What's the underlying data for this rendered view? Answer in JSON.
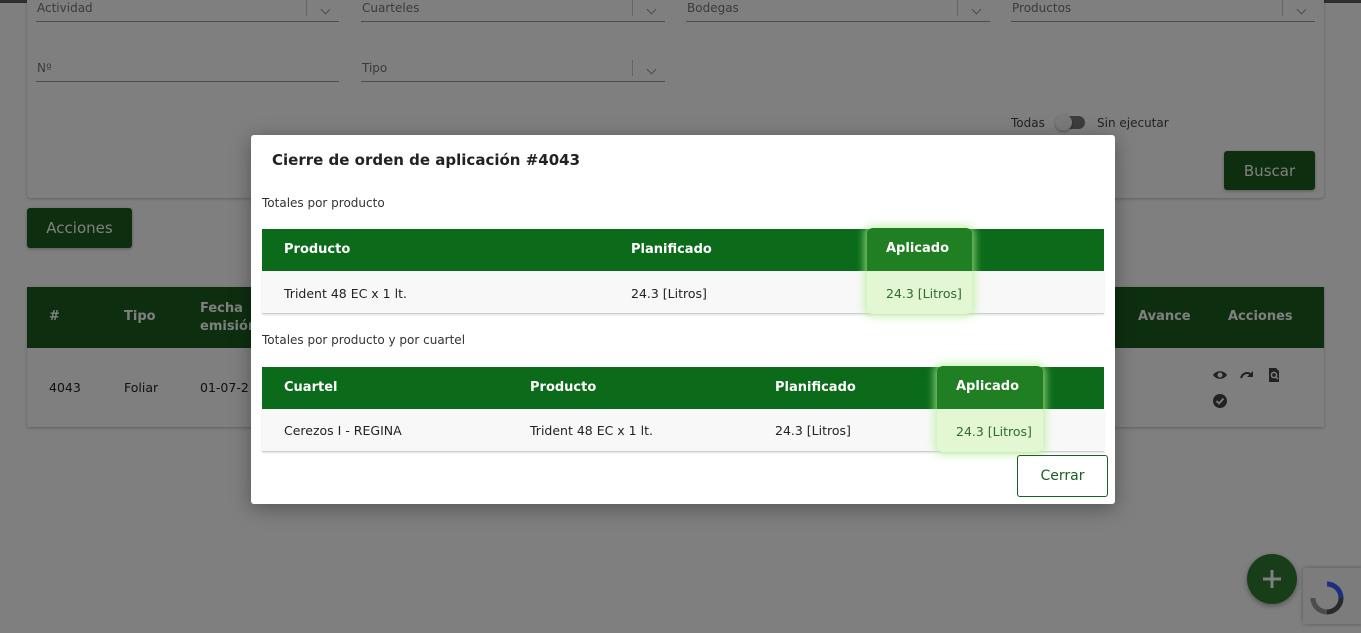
{
  "filters": {
    "actividad": "Actividad",
    "cuarteles": "Cuarteles",
    "bodegas": "Bodegas",
    "productos": "Productos",
    "numero": "Nº",
    "tipo": "Tipo",
    "toggle_left": "Todas",
    "toggle_right": "Sin ejecutar",
    "buscar": "Buscar"
  },
  "acciones_button": "Acciones",
  "orders_table": {
    "headers": [
      "#",
      "Tipo",
      "Fecha emisión",
      "Avance",
      "Acciones"
    ],
    "row": {
      "num": "4043",
      "tipo": "Foliar",
      "fecha": "01-07-2"
    }
  },
  "modal": {
    "title": "Cierre de orden de aplicación #4043",
    "section1": "Totales por producto",
    "table1": {
      "headers": [
        "Producto",
        "Planificado",
        "Aplicado"
      ],
      "row": [
        "Trident 48 EC x 1 lt.",
        "24.3 [Litros]",
        "24.3 [Litros]"
      ]
    },
    "section2": "Totales por producto y por cuartel",
    "table2": {
      "headers": [
        "Cuartel",
        "Producto",
        "Planificado",
        "Aplicado"
      ],
      "row": [
        "Cerezos I - REGINA",
        "Trident 48 EC x 1 lt.",
        "24.3 [Litros]",
        "24.3 [Litros]"
      ]
    },
    "close": "Cerrar"
  },
  "colors": {
    "primary": "#1b5e20",
    "header": "#0b6b1a",
    "highlight": "#e3f7d5"
  }
}
